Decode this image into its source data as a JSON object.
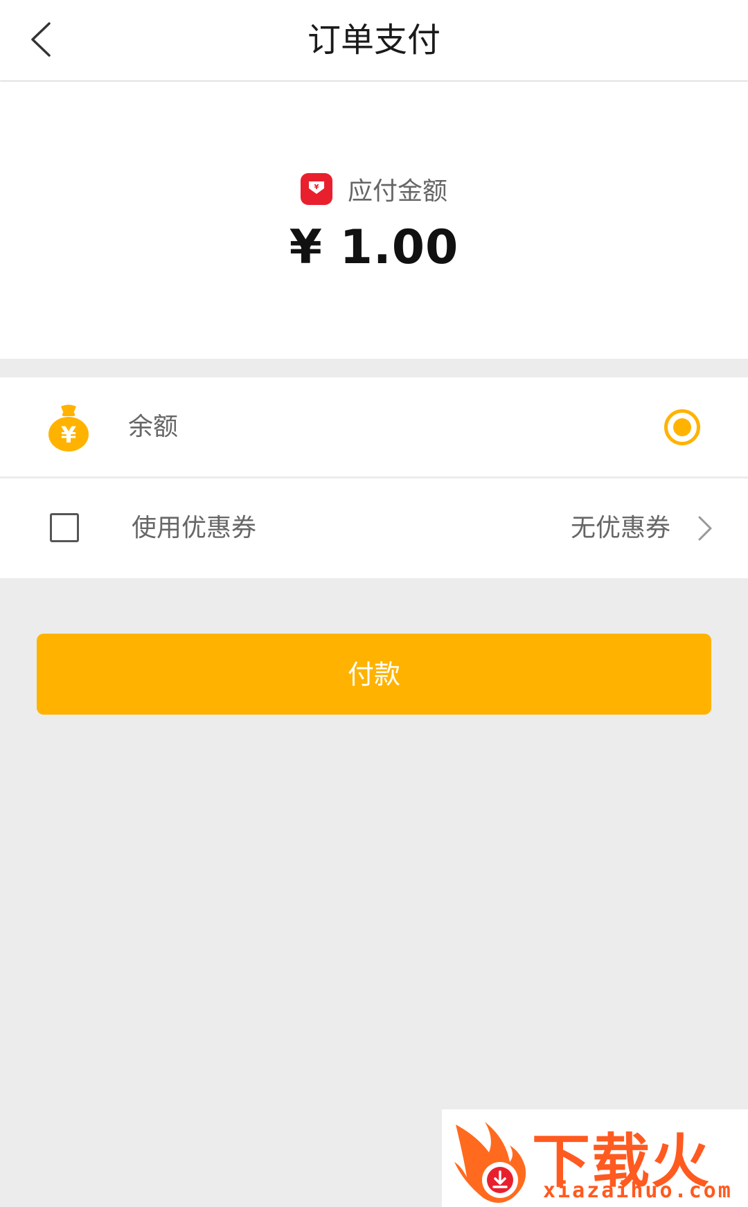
{
  "header": {
    "title": "订单支付",
    "back_icon": "chevron-left-icon"
  },
  "amount": {
    "label": "应付金额",
    "value": "¥ 1.00",
    "icon": "red-packet-icon",
    "icon_color": "#e8202e"
  },
  "payment_methods": [
    {
      "label": "余额",
      "icon": "money-bag-icon",
      "selected": true
    }
  ],
  "coupon": {
    "label": "使用优惠券",
    "status": "无优惠券",
    "checked": false
  },
  "pay_button": {
    "label": "付款",
    "color": "#ffb300"
  },
  "watermark": {
    "main": "下载火",
    "sub": "xiazaihuo.com"
  },
  "colors": {
    "accent": "#ffb300",
    "background": "#ececec"
  }
}
